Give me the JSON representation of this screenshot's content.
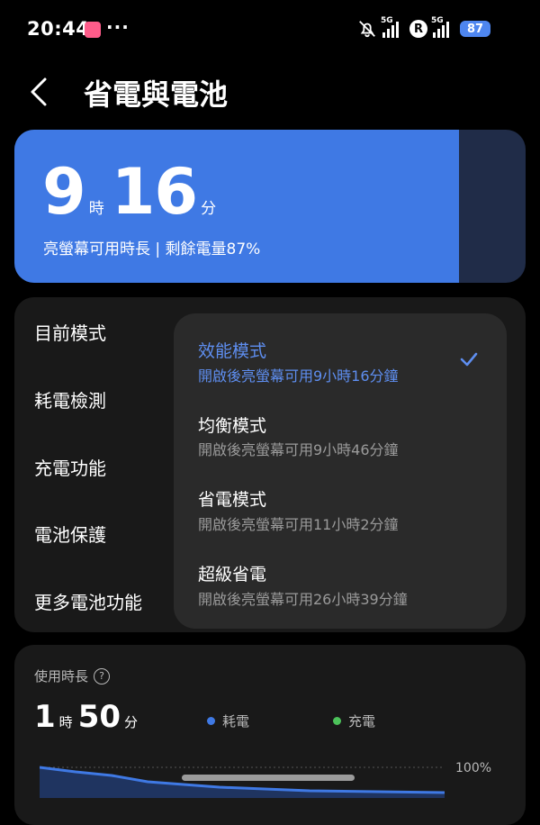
{
  "status_bar": {
    "time": "20:44",
    "more": "···",
    "net1": "5G",
    "net2": "5G",
    "roaming": "R",
    "battery": "87"
  },
  "header": {
    "title": "省電與電池"
  },
  "battery_card": {
    "hours": "9",
    "hours_unit": "時",
    "minutes": "16",
    "minutes_unit": "分",
    "subtitle": "亮螢幕可用時長 | 剩餘電量87%",
    "level_percent": 87
  },
  "menu": {
    "items": [
      "目前模式",
      "耗電檢測",
      "充電功能",
      "電池保護",
      "更多電池功能"
    ]
  },
  "mode_popup": {
    "options": [
      {
        "title": "效能模式",
        "subtitle": "開啟後亮螢幕可用9小時16分鐘",
        "selected": true
      },
      {
        "title": "均衡模式",
        "subtitle": "開啟後亮螢幕可用9小時46分鐘",
        "selected": false
      },
      {
        "title": "省電模式",
        "subtitle": "開啟後亮螢幕可用11小時2分鐘",
        "selected": false
      },
      {
        "title": "超級省電",
        "subtitle": "開啟後亮螢幕可用26小時39分鐘",
        "selected": false
      }
    ]
  },
  "usage": {
    "label": "使用時長",
    "help": "?",
    "hours": "1",
    "hours_unit": "時",
    "minutes": "50",
    "minutes_unit": "分",
    "legend_drain": "耗電",
    "legend_charge": "充電",
    "axis_max": "100%"
  },
  "colors": {
    "accent": "#3f79e4",
    "selected_text": "#5e8ef0",
    "drain": "#3f79e4",
    "charge": "#4cc25a"
  }
}
